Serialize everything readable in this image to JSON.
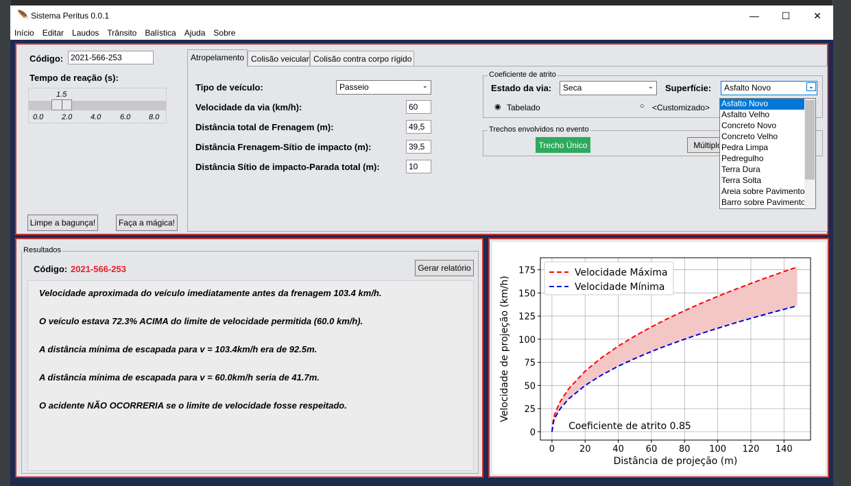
{
  "window": {
    "title": "Sistema Peritus 0.0.1",
    "minimize": "—",
    "maximize": "☐",
    "close": "✕"
  },
  "menu": [
    "Início",
    "Editar",
    "Laudos",
    "Trânsito",
    "Balística",
    "Ajuda",
    "Sobre"
  ],
  "left_panel": {
    "codigo_label": "Código:",
    "codigo_value": "2021-566-253",
    "tempo_label": "Tempo de reação (s):",
    "slider_value": "1.5",
    "slider_level": 1.5,
    "slider_ticks": [
      "0.0",
      "2.0",
      "4.0",
      "6.0",
      "8.0"
    ],
    "clear_button": "Limpe a bagunça!",
    "magic_button": "Faça a mágica!"
  },
  "tabs": [
    "Atropelamento",
    "Colisão veicular",
    "Colisão contra corpo rígido"
  ],
  "form": {
    "tipo_label": "Tipo de veículo:",
    "tipo_value": "Passeio",
    "vel_label": "Velocidade da via (km/h):",
    "vel_value": "60",
    "dist_total_label": "Distância total de Frenagem (m):",
    "dist_total_value": "49,5",
    "dist_frenagem_label": "Distância Frenagem-Sítio de impacto (m):",
    "dist_frenagem_value": "39,5",
    "dist_sitio_label": "Distância Sítio de impacto-Parada total (m):",
    "dist_sitio_value": "10"
  },
  "atrito": {
    "group_title": "Coeficiente de atrito",
    "estado_label": "Estado da via:",
    "estado_value": "Seca",
    "superficie_label": "Superfície:",
    "superficie_value": "Asfalto Novo",
    "radio_tabelado": "Tabelado",
    "radio_custom": "<Customizado>",
    "dropdown_options": [
      "Asfalto Novo",
      "Asfalto Velho",
      "Concreto Novo",
      "Concreto Velho",
      "Pedra Limpa",
      "Pedregulho",
      "Terra Dura",
      "Terra Solta",
      "Areia sobre Pavimento",
      "Barro sobre Pavimento"
    ]
  },
  "trechos": {
    "group_title": "Trechos envolvidos no evento",
    "unico": "Trecho Único",
    "multiplo": "Múltiplo"
  },
  "resultados": {
    "group_title": "Resultados",
    "codigo_label": "Código:",
    "codigo_value": "2021-566-253",
    "report_button": "Gerar relatório",
    "lines": [
      "Velocidade aproximada do veículo imediatamente antes da frenagem 103.4 km/h.",
      "O veículo estava 72.3% ACIMA do limite de velocidade permitida (60.0 km/h).",
      "A distância mínima de escapada para v = 103.4km/h era de 92.5m.",
      "A distância mínima de escapada para v = 60.0km/h seria de 41.7m.",
      "O acidente NÃO OCORRERIA se o limite de velocidade fosse respeitado."
    ]
  },
  "colors": {
    "accent_red": "#e8202a",
    "trecho_green": "#2eaa5e",
    "max_line": "#ff0000",
    "min_line": "#0000dd",
    "fill": "#f4c7c7"
  },
  "chart_data": {
    "type": "line",
    "xlabel": "Distância de projeção (m)",
    "ylabel": "Velocidade de projeção (km/h)",
    "xlim": [
      -7,
      156
    ],
    "ylim": [
      -9,
      188
    ],
    "xticks": [
      0,
      20,
      40,
      60,
      80,
      100,
      120,
      140
    ],
    "yticks": [
      0,
      25,
      50,
      75,
      100,
      125,
      150,
      175
    ],
    "grid": true,
    "legend_position": "top-left",
    "annotation": "Coeficiente de atrito 0.85",
    "series": [
      {
        "name": "Velocidade Máxima",
        "style": "dashed",
        "color": "#ff0000",
        "x": [
          0,
          1,
          2,
          5,
          10,
          20,
          30,
          40,
          50,
          60,
          70,
          80,
          90,
          100,
          110,
          120,
          130,
          140,
          148
        ],
        "y": [
          0,
          14.6,
          20.7,
          32.7,
          46.3,
          65.4,
          80.1,
          92.5,
          103.4,
          113.3,
          122.4,
          130.8,
          138.8,
          146.3,
          153.4,
          160.2,
          166.8,
          173.1,
          178.0
        ]
      },
      {
        "name": "Velocidade Mínima",
        "style": "dashed",
        "color": "#0000dd",
        "x": [
          0,
          1,
          2,
          5,
          10,
          20,
          30,
          40,
          50,
          60,
          70,
          80,
          90,
          100,
          110,
          120,
          130,
          140,
          148
        ],
        "y": [
          0,
          11.2,
          15.8,
          25.0,
          35.4,
          50.0,
          61.3,
          70.8,
          79.1,
          86.7,
          93.6,
          100.0,
          106.1,
          111.8,
          117.3,
          122.5,
          127.5,
          132.3,
          136.0
        ]
      }
    ]
  }
}
